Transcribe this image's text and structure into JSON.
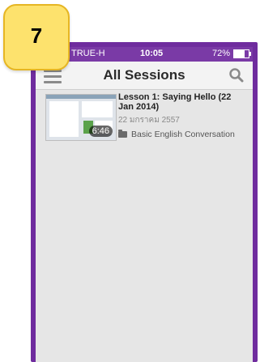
{
  "badge": {
    "number": "7"
  },
  "status_bar": {
    "carrier": "TRUE-H",
    "time": "10:05",
    "battery": "72%"
  },
  "nav": {
    "title": "All Sessions"
  },
  "sessions": [
    {
      "title": "Lesson 1: Saying Hello (22 Jan 2014)",
      "date": "22 มกราคม 2557",
      "folder": "Basic English Conversation",
      "duration": "6:46"
    }
  ],
  "colors": {
    "frame": "#6f2c9e",
    "badge": "#fde26d"
  }
}
